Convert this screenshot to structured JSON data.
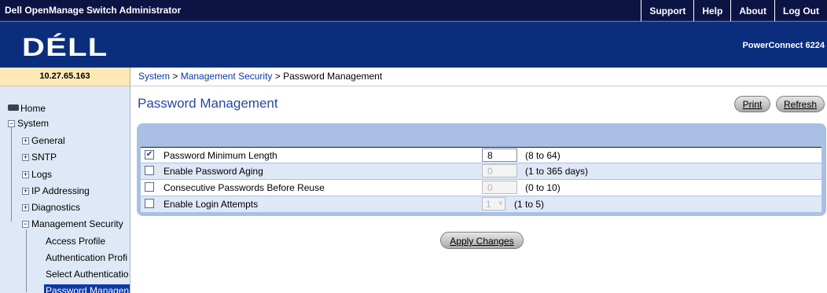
{
  "app": {
    "title": "Dell OpenManage Switch Administrator"
  },
  "toplinks": [
    "Support",
    "Help",
    "About",
    "Log Out"
  ],
  "banner": {
    "logo": "DÉLL",
    "product": "PowerConnect 6224"
  },
  "device": {
    "ip": "10.27.65.163"
  },
  "breadcrumb": {
    "system": "System",
    "sep1": " > ",
    "security": "Management Security",
    "sep2": " > ",
    "current": "Password Management"
  },
  "nav": {
    "home": "Home",
    "system": "System",
    "general": "General",
    "sntp": "SNTP",
    "logs": "Logs",
    "ip_addressing": "IP Addressing",
    "diagnostics": "Diagnostics",
    "management_security": "Management Security",
    "access_profile": "Access Profile",
    "authentication_profile": "Authentication Profi",
    "select_authentication": "Select Authenticatio",
    "password_management": "Password Managen"
  },
  "page": {
    "title": "Password Management",
    "print": "Print",
    "refresh": "Refresh",
    "apply": "Apply Changes"
  },
  "icons": {
    "expand": "plus-icon",
    "collapse": "minus-icon",
    "home": "home-icon"
  },
  "colors": {
    "header_bg": "#0c1444",
    "banner_bg": "#0a2e7c",
    "nav_bg": "#dfe8f6",
    "panel_bg": "#a9c0e4",
    "title_color": "#1f4aa0",
    "selected_bg": "#0b3aa6"
  },
  "form": {
    "rows": [
      {
        "label": "Password Minimum Length",
        "checked": true,
        "value": "8",
        "range": "(8 to 64)",
        "enabled": true
      },
      {
        "label": "Enable Password Aging",
        "checked": false,
        "value": "0",
        "range": "(1 to 365 days)",
        "enabled": false
      },
      {
        "label": "Consecutive Passwords Before Reuse",
        "checked": false,
        "value": "0",
        "range": "(0 to 10)",
        "enabled": false
      },
      {
        "label": "Enable Login Attempts",
        "checked": false,
        "value": "1",
        "range": "(1 to 5)",
        "enabled": false
      }
    ]
  }
}
